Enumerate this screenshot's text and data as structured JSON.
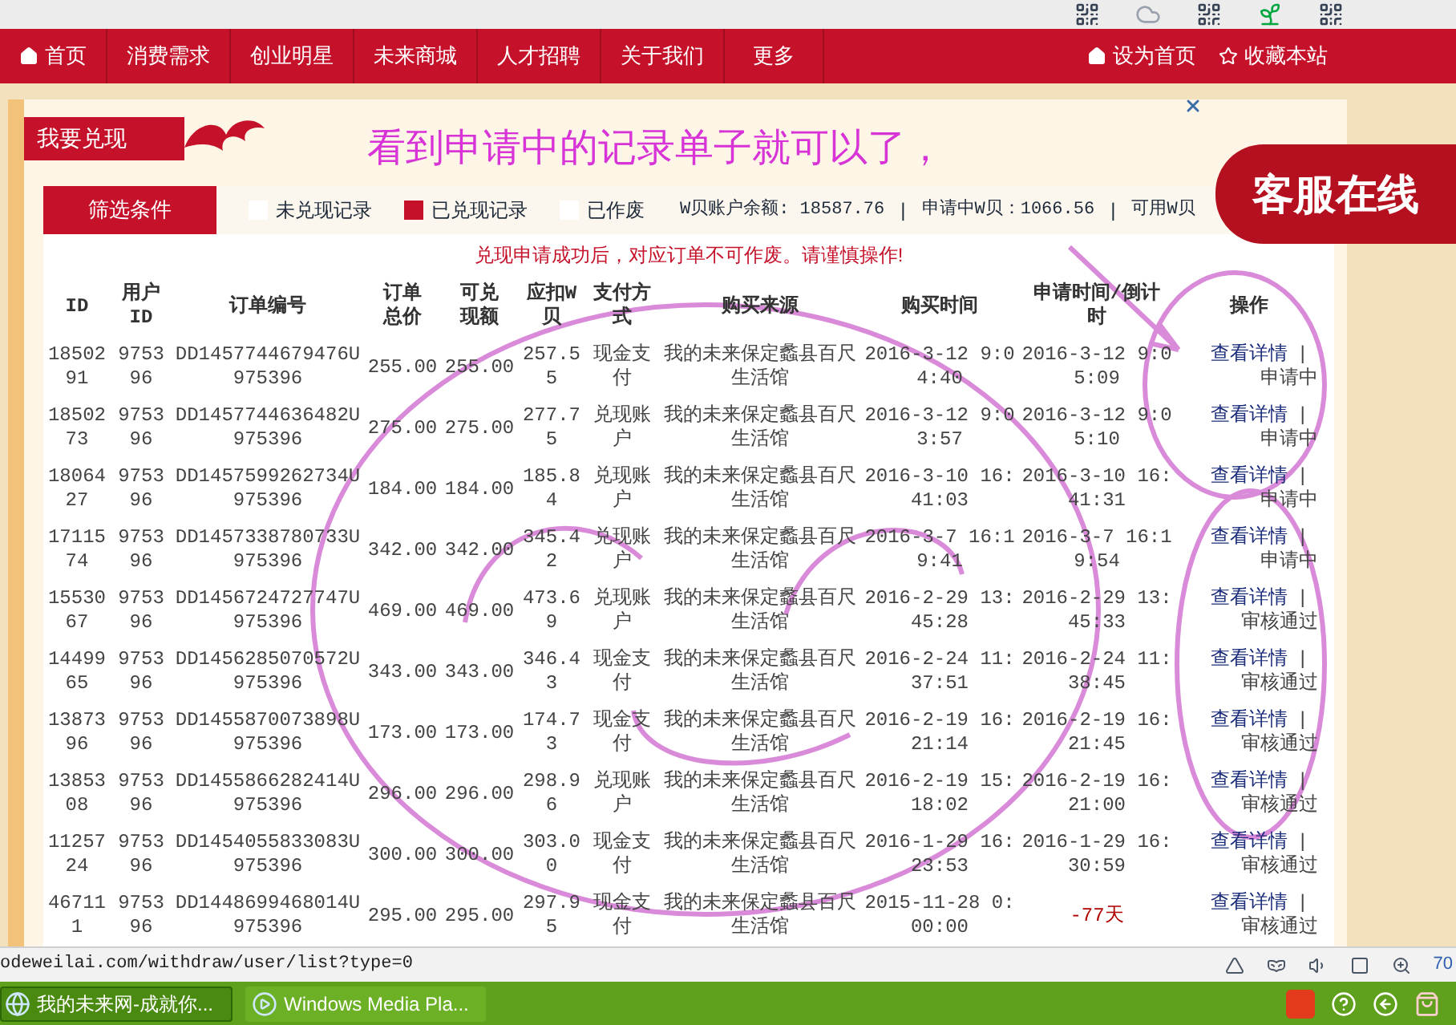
{
  "nav": {
    "left": [
      {
        "label": "首页",
        "kind": "home"
      },
      {
        "label": "消费需求",
        "kind": "plain"
      },
      {
        "label": "创业明星",
        "kind": "plain"
      },
      {
        "label": "未来商城",
        "kind": "plain"
      },
      {
        "label": "人才招聘",
        "kind": "plain"
      },
      {
        "label": "关于我们",
        "kind": "plain"
      },
      {
        "label": "更多",
        "kind": "plain"
      }
    ],
    "right": [
      {
        "label": "设为首页",
        "kind": "home"
      },
      {
        "label": "收藏本站",
        "kind": "favorite"
      }
    ]
  },
  "panel": {
    "title": "我要兑现"
  },
  "annotation": {
    "text": "看到申请中的记录单子就可以了，"
  },
  "service_badge": {
    "label": "客服在线"
  },
  "filter": {
    "label": "筛选条件",
    "options": [
      {
        "label": "未兑现记录",
        "selected": false
      },
      {
        "label": "已兑现记录",
        "selected": true
      },
      {
        "label": "已作废",
        "selected": false
      }
    ],
    "balances": [
      "W贝账户余额: 18587.76",
      "申请中W贝：1066.56",
      "可用W贝"
    ],
    "separator": "|"
  },
  "notice": "兑现申请成功后，对应订单不可作废。请谨慎操作!",
  "table": {
    "columns": [
      "ID",
      "用户ID",
      "订单编号",
      "订单总价",
      "可兑现额",
      "应扣W贝",
      "支付方式",
      "购买来源",
      "购买时间",
      "申请时间/倒计时",
      "操作"
    ],
    "rows": [
      {
        "cells": [
          "1850291",
          "975396",
          "DD1457744679476U975396",
          "255.00",
          "255.00",
          "257.55",
          "现金支付",
          "我的未来保定蠡县百尺生活馆",
          "2016-3-12 9:04:40",
          "2016-3-12 9:05:09"
        ],
        "countdown": false,
        "action": "查看详情",
        "separator": "|",
        "status": "申请中"
      },
      {
        "cells": [
          "1850273",
          "975396",
          "DD1457744636482U975396",
          "275.00",
          "275.00",
          "277.75",
          "兑现账户",
          "我的未来保定蠡县百尺生活馆",
          "2016-3-12 9:03:57",
          "2016-3-12 9:05:10"
        ],
        "countdown": false,
        "action": "查看详情",
        "separator": "|",
        "status": "申请中"
      },
      {
        "cells": [
          "1806427",
          "975396",
          "DD1457599262734U975396",
          "184.00",
          "184.00",
          "185.84",
          "兑现账户",
          "我的未来保定蠡县百尺生活馆",
          "2016-3-10 16:41:03",
          "2016-3-10 16:41:31"
        ],
        "countdown": false,
        "action": "查看详情",
        "separator": "|",
        "status": "申请中"
      },
      {
        "cells": [
          "1711574",
          "975396",
          "DD1457338780733U975396",
          "342.00",
          "342.00",
          "345.42",
          "兑现账户",
          "我的未来保定蠡县百尺生活馆",
          "2016-3-7 16:19:41",
          "2016-3-7 16:19:54"
        ],
        "countdown": false,
        "action": "查看详情",
        "separator": "|",
        "status": "申请中"
      },
      {
        "cells": [
          "1553067",
          "975396",
          "DD1456724727747U975396",
          "469.00",
          "469.00",
          "473.69",
          "兑现账户",
          "我的未来保定蠡县百尺生活馆",
          "2016-2-29 13:45:28",
          "2016-2-29 13:45:33"
        ],
        "countdown": false,
        "action": "查看详情",
        "separator": "|",
        "status": "审核通过"
      },
      {
        "cells": [
          "1449965",
          "975396",
          "DD1456285070572U975396",
          "343.00",
          "343.00",
          "346.43",
          "现金支付",
          "我的未来保定蠡县百尺生活馆",
          "2016-2-24 11:37:51",
          "2016-2-24 11:38:45"
        ],
        "countdown": false,
        "action": "查看详情",
        "separator": "|",
        "status": "审核通过"
      },
      {
        "cells": [
          "1387396",
          "975396",
          "DD1455870073898U975396",
          "173.00",
          "173.00",
          "174.73",
          "现金支付",
          "我的未来保定蠡县百尺生活馆",
          "2016-2-19 16:21:14",
          "2016-2-19 16:21:45"
        ],
        "countdown": false,
        "action": "查看详情",
        "separator": "|",
        "status": "审核通过"
      },
      {
        "cells": [
          "1385308",
          "975396",
          "DD1455866282414U975396",
          "296.00",
          "296.00",
          "298.96",
          "兑现账户",
          "我的未来保定蠡县百尺生活馆",
          "2016-2-19 15:18:02",
          "2016-2-19 16:21:00"
        ],
        "countdown": false,
        "action": "查看详情",
        "separator": "|",
        "status": "审核通过"
      },
      {
        "cells": [
          "1125724",
          "975396",
          "DD1454055833083U975396",
          "300.00",
          "300.00",
          "303.00",
          "现金支付",
          "我的未来保定蠡县百尺生活馆",
          "2016-1-29 16:23:53",
          "2016-1-29 16:30:59"
        ],
        "countdown": false,
        "action": "查看详情",
        "separator": "|",
        "status": "审核通过"
      },
      {
        "cells": [
          "467111",
          "975396",
          "DD1448699468014U975396",
          "295.00",
          "295.00",
          "297.95",
          "现金支付",
          "我的未来保定蠡县百尺生活馆",
          "2015-11-28 0:00:00",
          "-77天"
        ],
        "countdown": true,
        "action": "查看详情",
        "separator": "|",
        "status": "审核通过"
      }
    ]
  },
  "status_bar": {
    "url": "odeweilai.com/withdraw/user/list?type=0",
    "zoom": "70"
  },
  "taskbar": {
    "tasks": [
      {
        "label": "我的未来网-成就你...",
        "selected": true
      },
      {
        "label": "Windows Media Pla...",
        "selected": false
      }
    ]
  }
}
